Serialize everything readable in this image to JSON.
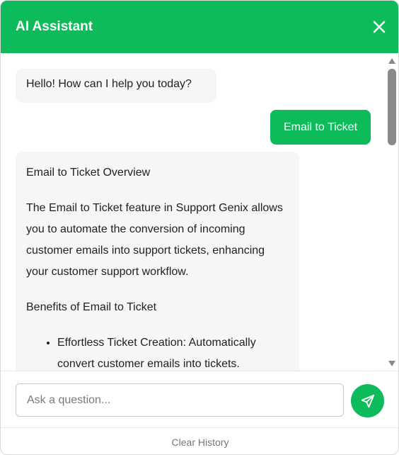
{
  "header": {
    "title": "AI Assistant",
    "close_icon": "close-icon"
  },
  "colors": {
    "accent": "#0dbb5b",
    "bot_bubble": "#f6f6f6"
  },
  "messages": {
    "greeting": "Hello! How can I help you today?",
    "user_message": "Email to Ticket",
    "answer": {
      "heading": "Email to Ticket Overview",
      "paragraph": "The Email to Ticket feature in Support Genix allows you to automate the conversion of incoming customer emails into support tickets, enhancing your customer support workflow.",
      "subheading": "Benefits of Email to Ticket",
      "bullets": [
        "Effortless Ticket Creation: Automatically convert customer emails into tickets."
      ]
    }
  },
  "input": {
    "placeholder": "Ask a question...",
    "value": "",
    "send_icon": "send-icon"
  },
  "footer": {
    "clear_label": "Clear History"
  }
}
